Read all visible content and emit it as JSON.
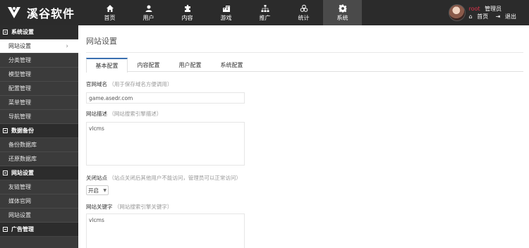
{
  "brand": {
    "name": "溪谷软件"
  },
  "nav": [
    {
      "label": "首页",
      "icon": "home-icon"
    },
    {
      "label": "用户",
      "icon": "user-icon"
    },
    {
      "label": "内容",
      "icon": "puzzle-icon"
    },
    {
      "label": "游戏",
      "icon": "building-icon"
    },
    {
      "label": "推广",
      "icon": "sitemap-icon"
    },
    {
      "label": "统计",
      "icon": "cubes-icon"
    },
    {
      "label": "系统",
      "icon": "gear-icon"
    }
  ],
  "user": {
    "name": "root",
    "role": "管理员",
    "home_link": "首页",
    "logout_link": "退出"
  },
  "sidebar": {
    "groups": [
      {
        "title": "系统设置",
        "items": [
          "网站设置",
          "分类管理",
          "模型管理",
          "配置管理",
          "菜单管理",
          "导航管理"
        ]
      },
      {
        "title": "数据备份",
        "items": [
          "备份数据库",
          "还原数据库"
        ]
      },
      {
        "title": "网站设置",
        "items": [
          "友链管理",
          "媒体官网",
          "网站设置"
        ]
      },
      {
        "title": "广告管理",
        "items": []
      }
    ]
  },
  "main": {
    "title": "网站设置",
    "tabs": [
      "基本配置",
      "内容配置",
      "用户配置",
      "系统配置"
    ],
    "fields": {
      "domain": {
        "label": "官网域名",
        "hint": "（用于保存域名方便调用）",
        "value": "game.asedr.com"
      },
      "description": {
        "label": "网站描述",
        "hint": "（网站搜索引擎描述）",
        "value": "vlcms"
      },
      "close_site": {
        "label": "关闭站点",
        "hint": "（站点关闭后其他用户不能访问，管理员可以正常访问）",
        "value": "开启"
      },
      "keywords": {
        "label": "网站关键字",
        "hint": "（网站搜索引擎关键字）",
        "value": "vlcms"
      }
    }
  }
}
